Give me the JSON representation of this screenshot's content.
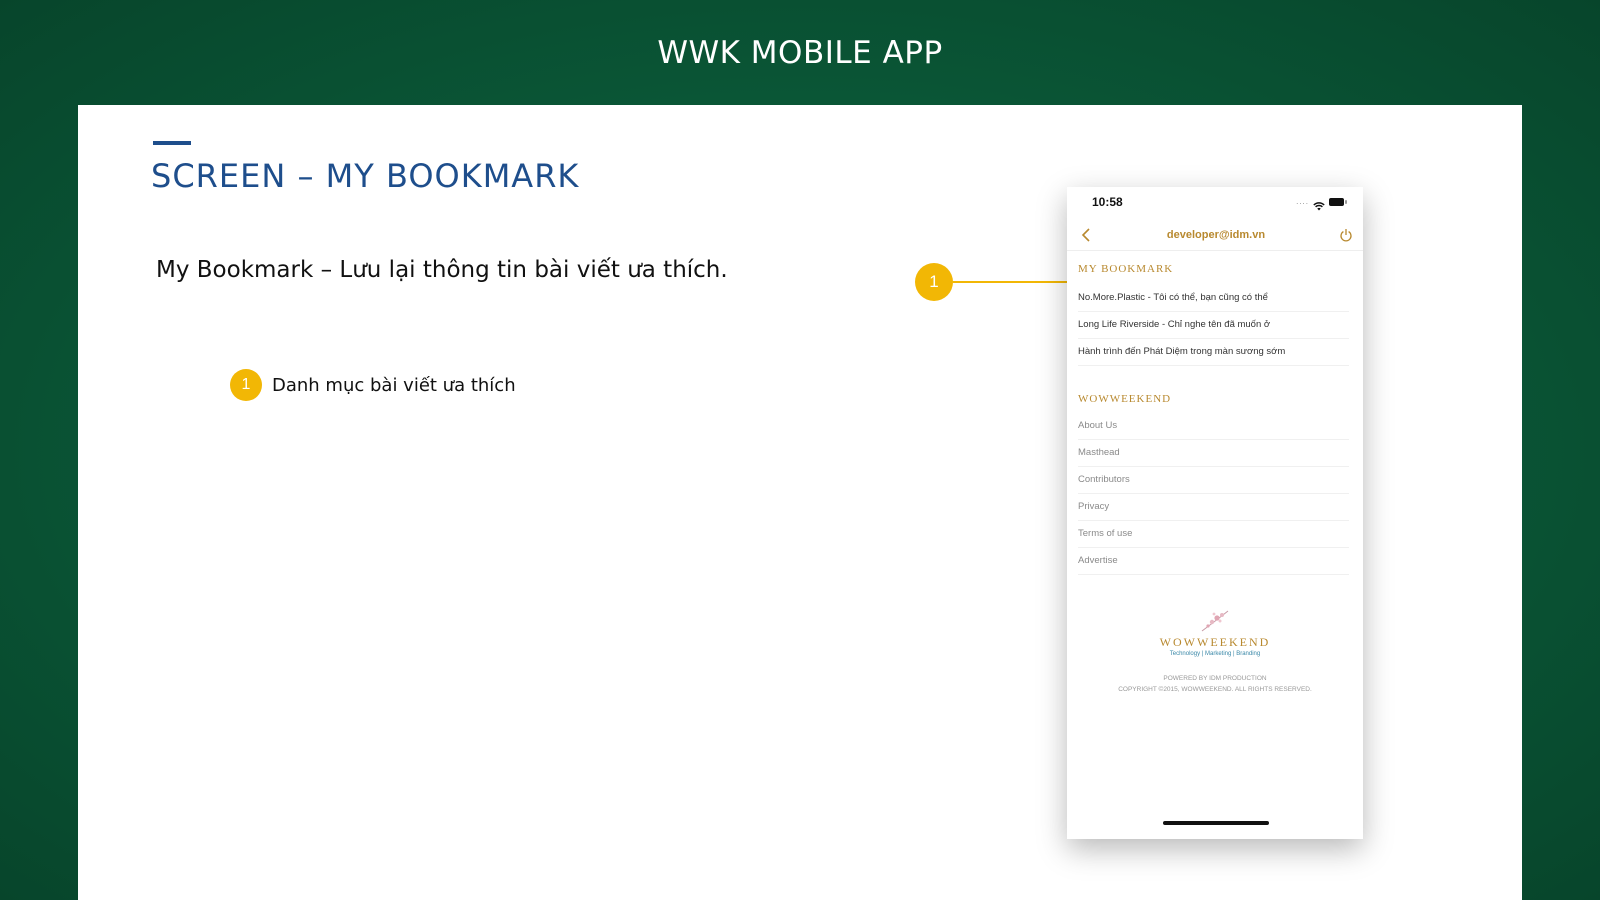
{
  "header": {
    "title": "WWK MOBILE APP"
  },
  "slide": {
    "title": "SCREEN – MY BOOKMARK",
    "description": "My Bookmark – Lưu lại thông tin bài viết ưa thích.",
    "legend": [
      {
        "number": "1",
        "text": "Danh mục bài viết ưa thích"
      }
    ],
    "callout": {
      "number": "1"
    }
  },
  "colors": {
    "brand_green": "#0a5636",
    "title_blue": "#1e4e8c",
    "badge_yellow": "#f2b705",
    "gold": "#b8892f"
  },
  "phone": {
    "status_bar": {
      "time": "10:58",
      "signal": "....",
      "icons": [
        "wifi-icon",
        "battery-icon"
      ]
    },
    "nav": {
      "title": "developer@idm.vn",
      "back_icon": "chevron-left-icon",
      "logout_icon": "power-icon"
    },
    "bookmark_section": {
      "title": "MY BOOKMARK",
      "items": [
        "No.More.Plastic - Tôi có thể, bạn cũng có thể",
        "Long Life Riverside - Chỉ nghe tên đã muốn ở",
        "Hành trình đến Phát Diệm trong màn sương sớm"
      ]
    },
    "menu_section": {
      "title": "WOWWEEKEND",
      "items": [
        "About Us",
        "Masthead",
        "Contributors",
        "Privacy",
        "Terms of use",
        "Advertise"
      ]
    },
    "footer": {
      "logo_text": "WOWWEEKEND",
      "tagline": "Technology | Marketing | Branding",
      "powered_by": "POWERED BY IDM PRODUCTION",
      "copyright": "COPYRIGHT ©2015, WOWWEEKEND. ALL RIGHTS RESERVED."
    }
  }
}
